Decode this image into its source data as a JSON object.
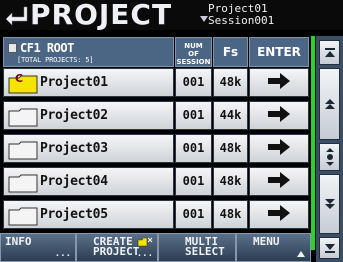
{
  "header": {
    "title": "PROJECT",
    "project": "Project01",
    "session": "Session001"
  },
  "table": {
    "root_label": "CF1 ROOT",
    "total_label": "[TOTAL PROJECTS:  5]",
    "col_num": [
      "NUM",
      "OF",
      "SESSION"
    ],
    "col_fs": "Fs",
    "col_enter": "ENTER",
    "rows": [
      {
        "name": "Project01",
        "sessions": "001",
        "fs": "48k",
        "current": true,
        "current_mark": "C"
      },
      {
        "name": "Project02",
        "sessions": "001",
        "fs": "44k",
        "current": false
      },
      {
        "name": "Project03",
        "sessions": "001",
        "fs": "48k",
        "current": false
      },
      {
        "name": "Project04",
        "sessions": "001",
        "fs": "48k",
        "current": false
      },
      {
        "name": "Project05",
        "sessions": "001",
        "fs": "48k",
        "current": false
      }
    ]
  },
  "bottom": {
    "info": "INFO",
    "create_1": "CREATE",
    "create_2": "PROJECT",
    "multi_1": "MULTI",
    "multi_2": "SELECT",
    "menu": "MENU",
    "ellipsis": "..."
  },
  "icons": {
    "back": "back-arrow-icon",
    "enter": "right-arrow-icon",
    "folder": "folder-icon",
    "scroll_top": "scroll-top-icon",
    "scroll_up": "scroll-up-icon",
    "scroll_pos": "scroll-position-icon",
    "scroll_down": "scroll-down-icon",
    "scroll_bottom": "scroll-bottom-icon"
  },
  "colors": {
    "current_folder": "#f5e400",
    "folder": "#f4f4f4",
    "accent_green": "#29d329"
  }
}
